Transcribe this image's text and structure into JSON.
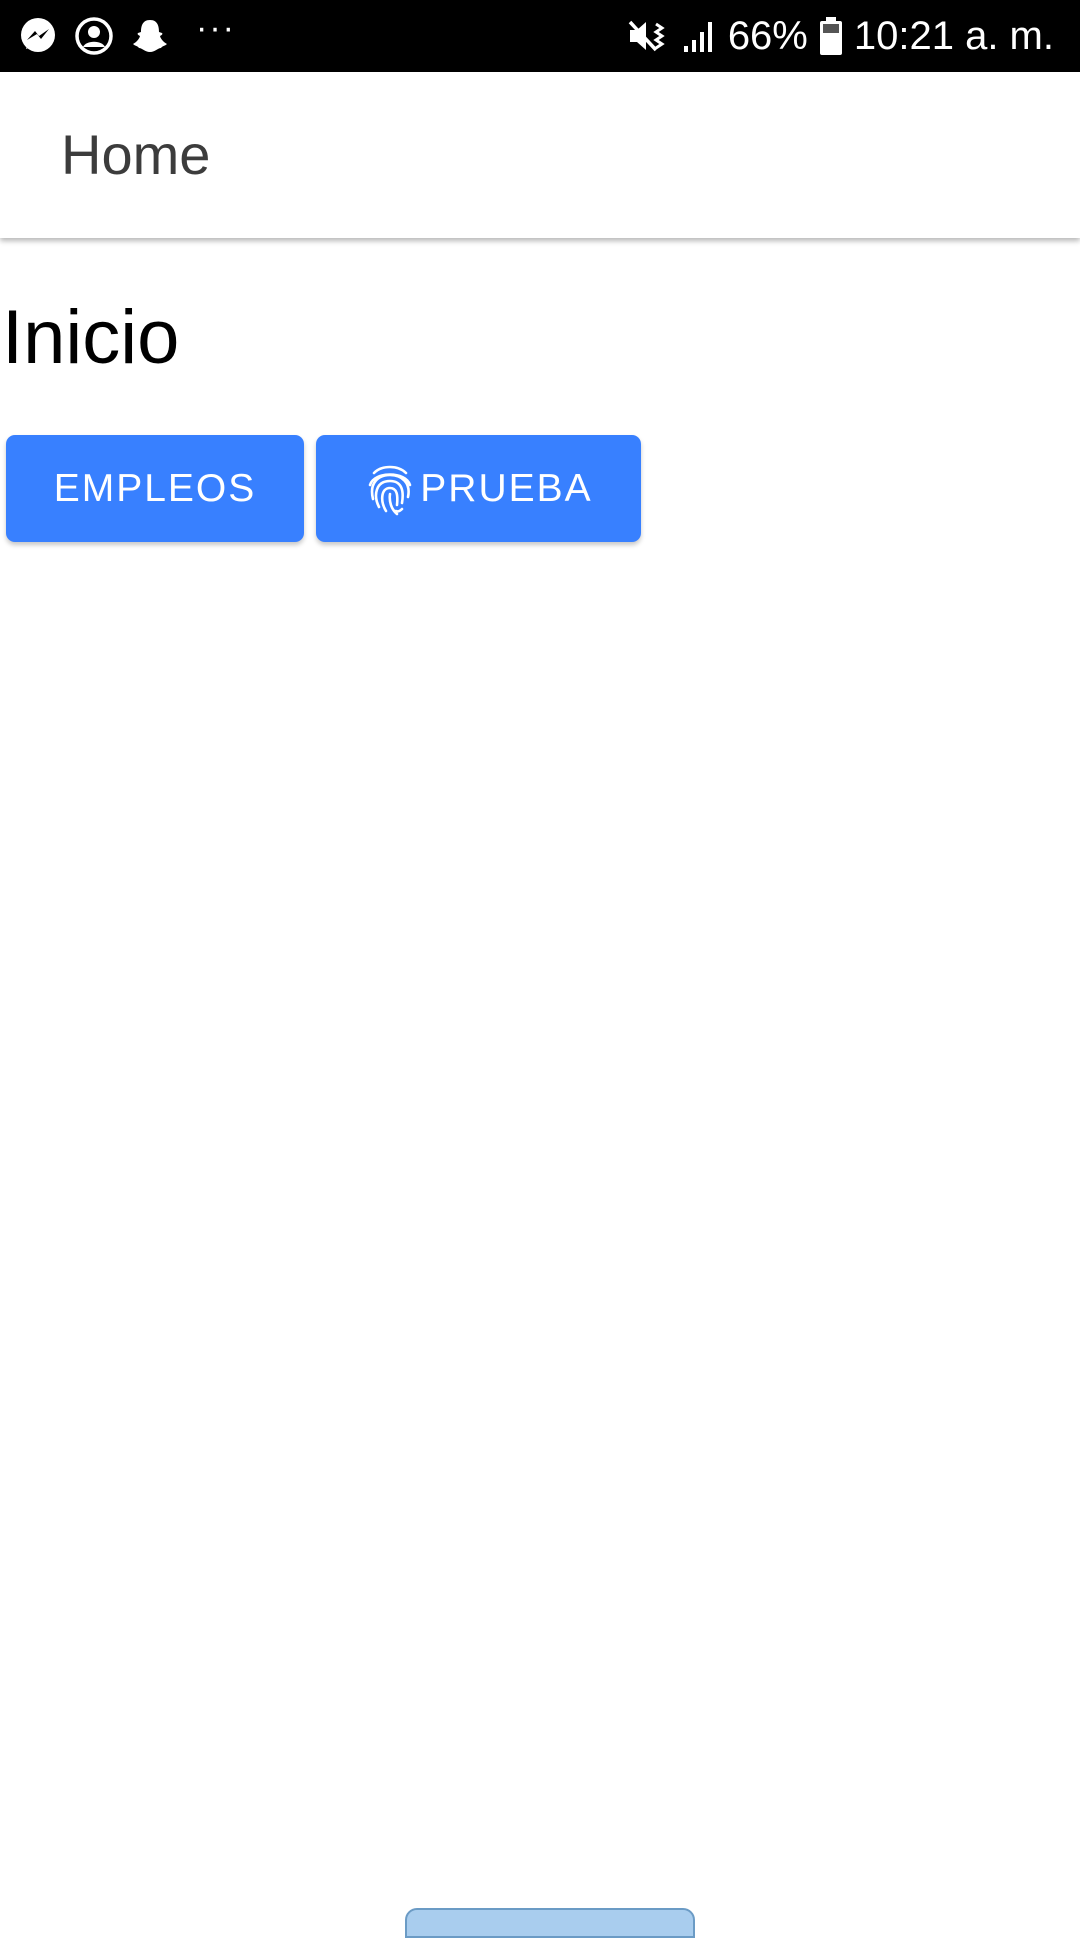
{
  "status_bar": {
    "left_icons": [
      "messenger-icon",
      "account-circle-icon",
      "snapchat-icon"
    ],
    "more_dots": "···",
    "battery_percent": "66%",
    "time": "10:21 a. m.",
    "right_icons": [
      "mute-vibrate-icon",
      "signal-icon",
      "battery-icon"
    ]
  },
  "app_bar": {
    "title": "Home"
  },
  "main": {
    "heading": "Inicio",
    "buttons": [
      {
        "label": "EMPLEOS"
      },
      {
        "label": "PRUEBA",
        "icon": "fingerprint-icon"
      }
    ]
  },
  "colors": {
    "primary": "#3880ff",
    "status_bar_bg": "#000000",
    "bottom_tab": "#a9cdee"
  }
}
